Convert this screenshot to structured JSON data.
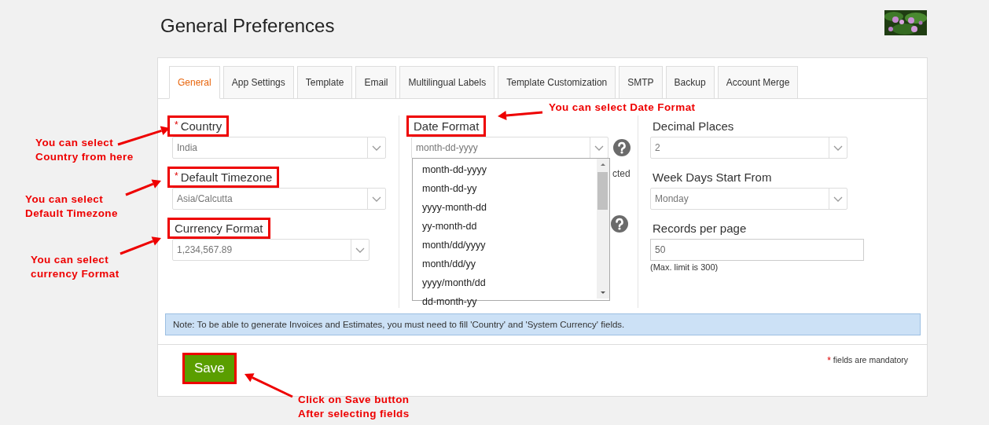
{
  "page": {
    "title": "General Preferences"
  },
  "tabs": [
    {
      "label": "General",
      "selected": true
    },
    {
      "label": "App Settings",
      "selected": false
    },
    {
      "label": "Template",
      "selected": false
    },
    {
      "label": "Email",
      "selected": false
    },
    {
      "label": "Multilingual Labels",
      "selected": false
    },
    {
      "label": "Template Customization",
      "selected": false
    },
    {
      "label": "SMTP",
      "selected": false
    },
    {
      "label": "Backup",
      "selected": false
    },
    {
      "label": "Account Merge",
      "selected": false
    }
  ],
  "columns": [
    {
      "fields": [
        {
          "kind": "select",
          "mark": "*",
          "label": "Country",
          "highlighted": true,
          "value": "India"
        },
        {
          "kind": "select",
          "mark": "*",
          "label": "Default Timezone",
          "highlighted": true,
          "value": "Asia/Calcutta"
        },
        {
          "kind": "select",
          "label": "Currency Format",
          "highlighted": true,
          "value": "1,234,567.89"
        }
      ]
    },
    {
      "fields": [
        {
          "kind": "select",
          "label": "Date Format",
          "highlighted": true,
          "value": "month-dd-yyyy",
          "help": true,
          "expanded": true,
          "options": [
            "month-dd-yyyy",
            "month-dd-yy",
            "yyyy-month-dd",
            "yy-month-dd",
            "month/dd/yyyy",
            "month/dd/yy",
            "yyyy/month/dd",
            "dd-month-yy"
          ]
        },
        {
          "kind": "covered",
          "text": "cted",
          "help": true
        }
      ]
    },
    {
      "fields": [
        {
          "kind": "select",
          "label": "Decimal Places",
          "highlighted": false,
          "value": "2"
        },
        {
          "kind": "select",
          "label": "Week Days Start From",
          "highlighted": false,
          "value": "Monday"
        },
        {
          "kind": "text",
          "label": "Records per page",
          "highlighted": false,
          "value": "50",
          "hint": "(Max. limit is 300)"
        }
      ]
    }
  ],
  "note": "Note: To be able to generate Invoices and Estimates, you must need to fill 'Country' and 'System Currency' fields.",
  "save_button": {
    "label": "Save",
    "highlighted": true
  },
  "mandatory_note": {
    "mark": "*",
    "text": "fields are mandatory"
  },
  "annotations": [
    {
      "lines": [
        "You can select",
        "Country from here"
      ]
    },
    {
      "lines": [
        "You can select",
        "Default Timezone"
      ]
    },
    {
      "lines": [
        "You can select",
        "currency Format"
      ]
    },
    {
      "lines": [
        "You can select Date Format"
      ]
    },
    {
      "lines": [
        "Click on Save button",
        "After selecting fields"
      ]
    }
  ]
}
